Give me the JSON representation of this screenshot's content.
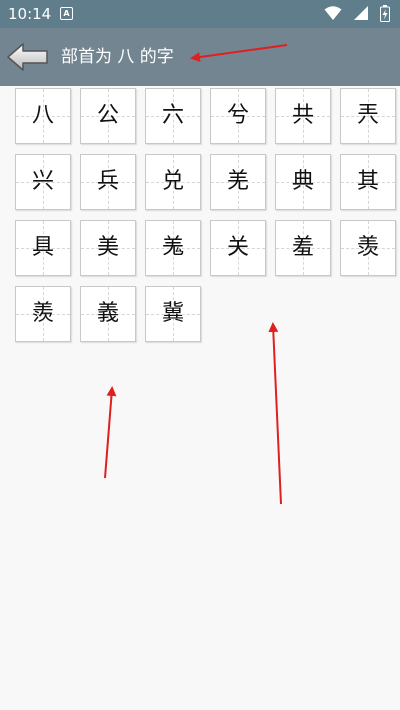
{
  "status_bar": {
    "time": "10:14",
    "notification_icon": "A"
  },
  "header": {
    "title": "部首为 八 的字",
    "back_icon": "back-arrow-icon"
  },
  "characters": [
    "八",
    "公",
    "六",
    "兮",
    "共",
    "兲",
    "兴",
    "兵",
    "兑",
    "羌",
    "典",
    "其",
    "具",
    "美",
    "羗",
    "关",
    "羞",
    "羡",
    "羨",
    "義",
    "冀"
  ],
  "colors": {
    "status_bar": "#607d8b",
    "app_bar": "#728590",
    "background": "#f8f8f8",
    "annotation_arrow": "#e02020"
  }
}
